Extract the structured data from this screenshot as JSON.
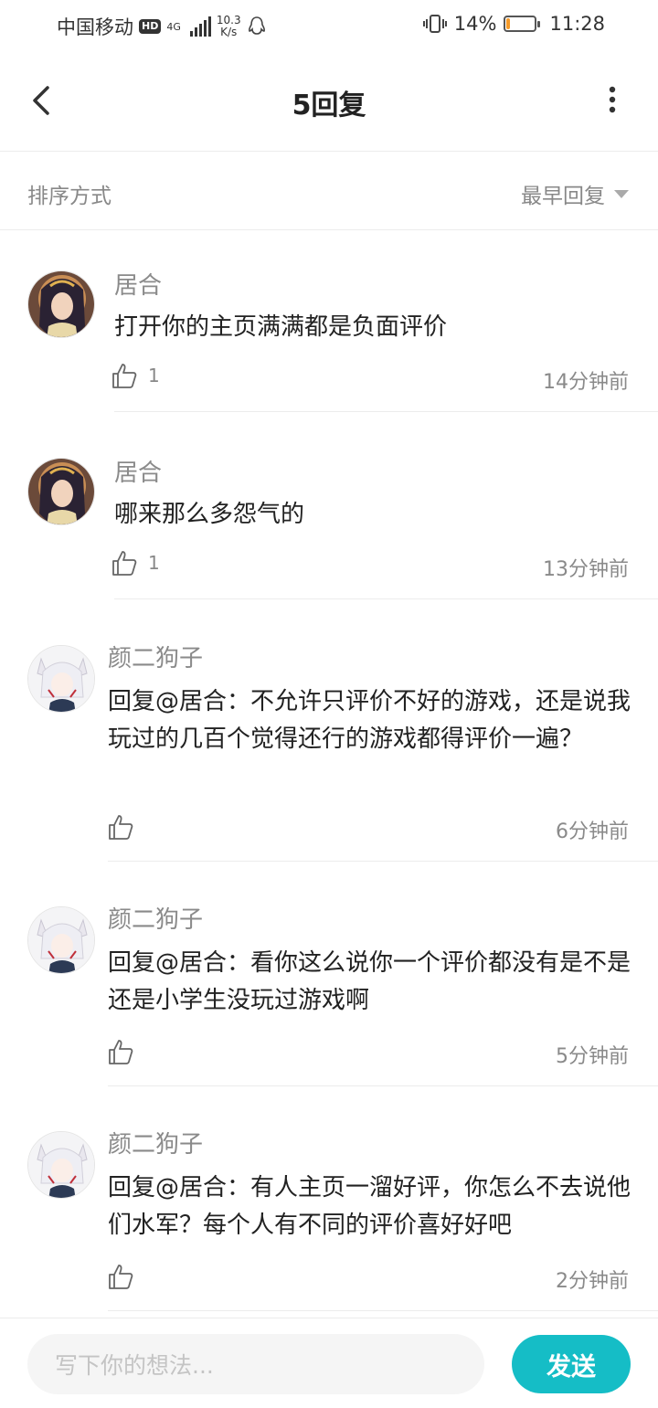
{
  "status_bar": {
    "carrier": "中国移动",
    "hd_badge": "HD",
    "network": "4G",
    "speed_value": "10.3",
    "speed_unit": "K/s",
    "battery_percent": "14%",
    "battery_level": 0.14,
    "time": "11:28",
    "icons": [
      "hd-icon",
      "signal-icon",
      "qq-icon",
      "vibrate-icon",
      "battery-icon"
    ]
  },
  "nav": {
    "title": "5回复",
    "icons": [
      "back-icon",
      "more-icon"
    ]
  },
  "sort": {
    "label": "排序方式",
    "selected": "最早回复"
  },
  "comments": [
    {
      "user": "居合",
      "text": "打开你的主页满满都是负面评价",
      "likes": "1",
      "time": "14分钟前"
    },
    {
      "user": "居合",
      "text": "哪来那么多怨气的",
      "likes": "1",
      "time": "13分钟前"
    },
    {
      "user": "颜二狗子",
      "text": "回复@居合：不允许只评价不好的游戏，还是说我玩过的几百个觉得还行的游戏都得评价一遍？",
      "likes": "",
      "time": "6分钟前"
    },
    {
      "user": "颜二狗子",
      "text": "回复@居合：看你这么说你一个评价都没有是不是还是小学生没玩过游戏啊",
      "likes": "",
      "time": "5分钟前"
    },
    {
      "user": "颜二狗子",
      "text": "回复@居合：有人主页一溜好评，你怎么不去说他们水军？每个人有不同的评价喜好好吧",
      "likes": "",
      "time": "2分钟前"
    }
  ],
  "input": {
    "placeholder": "写下你的想法...",
    "send_label": "发送"
  },
  "colors": {
    "accent": "#15bdc6",
    "battery": "#f59a2a",
    "muted_text": "#8a8a8a"
  }
}
